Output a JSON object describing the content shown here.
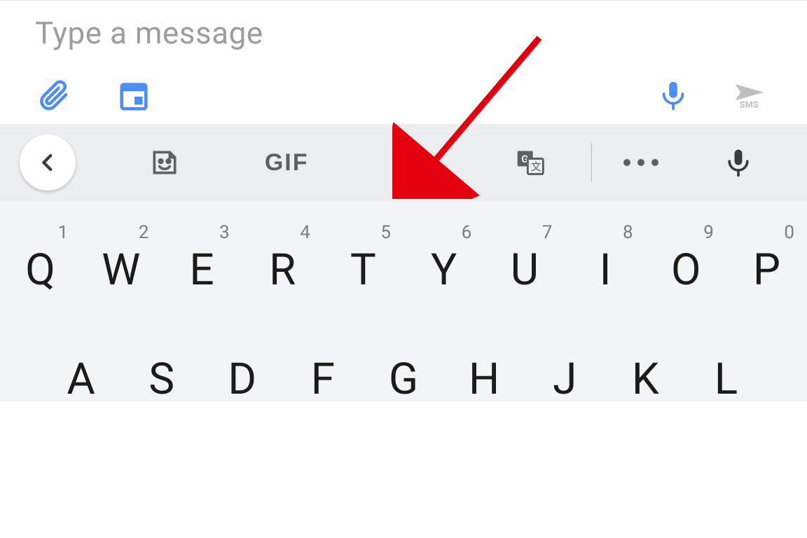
{
  "compose": {
    "placeholder": "Type a message",
    "send_label": "SMS"
  },
  "strip": {
    "gif": "GIF"
  },
  "keyboard": {
    "row1": [
      {
        "k": "Q",
        "h": "1"
      },
      {
        "k": "W",
        "h": "2"
      },
      {
        "k": "E",
        "h": "3"
      },
      {
        "k": "R",
        "h": "4"
      },
      {
        "k": "T",
        "h": "5"
      },
      {
        "k": "Y",
        "h": "6"
      },
      {
        "k": "U",
        "h": "7"
      },
      {
        "k": "I",
        "h": "8"
      },
      {
        "k": "O",
        "h": "9"
      },
      {
        "k": "P",
        "h": "0"
      }
    ],
    "row2": [
      {
        "k": "A"
      },
      {
        "k": "S"
      },
      {
        "k": "D"
      },
      {
        "k": "F"
      },
      {
        "k": "G"
      },
      {
        "k": "H"
      },
      {
        "k": "J"
      },
      {
        "k": "K"
      },
      {
        "k": "L"
      }
    ]
  },
  "annotation": {
    "target": "settings"
  }
}
